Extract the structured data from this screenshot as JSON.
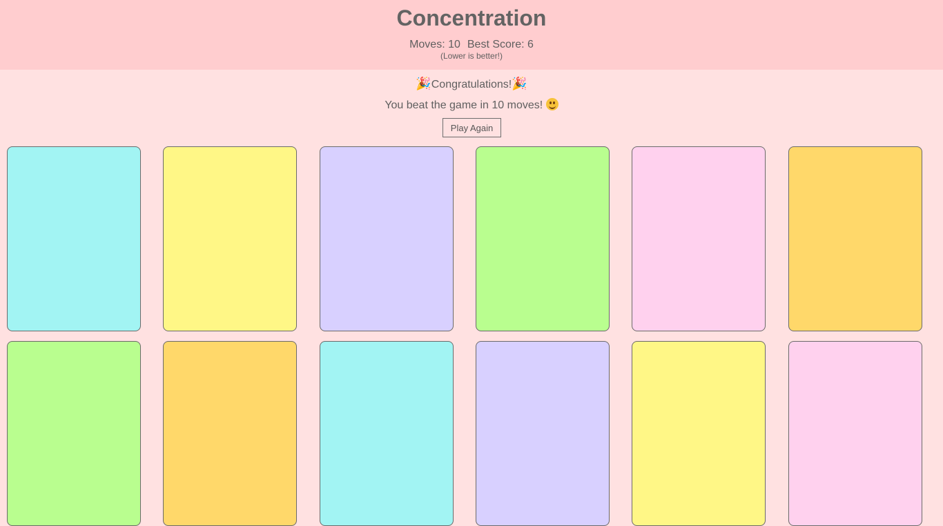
{
  "header": {
    "title": "Concentration",
    "moves_text": "Moves: 10",
    "best_score_text": "Best Score: 6",
    "hint": "(Lower is better!)"
  },
  "win": {
    "party_icon": "🎉",
    "congrats": "Congratulations!",
    "message": "You beat the game in 10 moves!",
    "smile_icon": "smiling-face-icon",
    "play_again_label": "Play Again"
  },
  "colors": {
    "header_bg": "#ffcdcf",
    "page_bg": "#ffe1e1",
    "cyan": "#a2f4f3",
    "yellow": "#fff786",
    "lavender": "#d8d0ff",
    "green": "#b9fe8f",
    "pink": "#ffd1ee",
    "orange": "#ffd86a"
  },
  "cards": [
    {
      "color": "#a2f4f3"
    },
    {
      "color": "#fff786"
    },
    {
      "color": "#d8d0ff"
    },
    {
      "color": "#b9fe8f"
    },
    {
      "color": "#ffd1ee"
    },
    {
      "color": "#ffd86a"
    },
    {
      "color": "#b9fe8f"
    },
    {
      "color": "#ffd86a"
    },
    {
      "color": "#a2f4f3"
    },
    {
      "color": "#d8d0ff"
    },
    {
      "color": "#fff786"
    },
    {
      "color": "#ffd1ee"
    }
  ]
}
